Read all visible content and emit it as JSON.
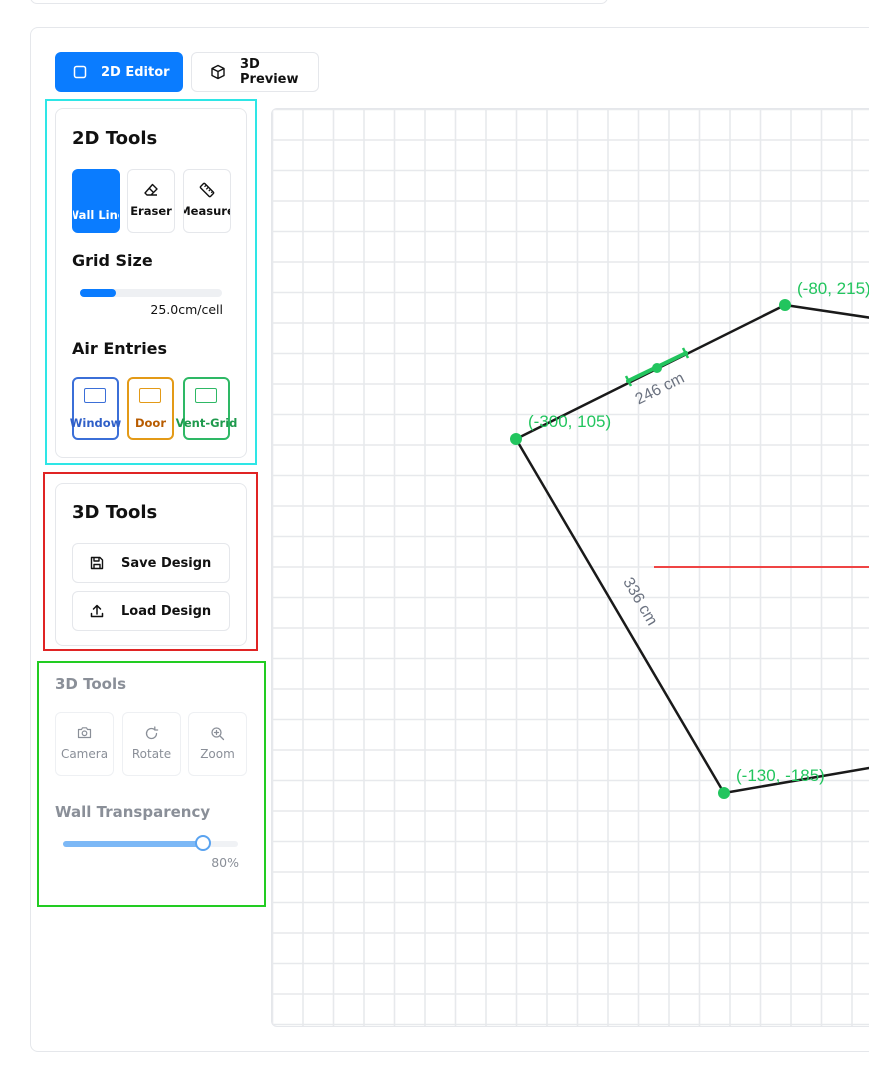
{
  "mode_tabs": {
    "editor_2d": "2D Editor",
    "preview_3d": "3D Preview",
    "active": "2D Editor"
  },
  "tools_2d": {
    "title": "2D Tools",
    "buttons": [
      {
        "label": "Wall Line",
        "icon": "wall-line-icon",
        "active": true
      },
      {
        "label": "Eraser",
        "icon": "eraser-icon",
        "active": false
      },
      {
        "label": "Measure",
        "icon": "ruler-icon",
        "active": false
      }
    ],
    "grid_size": {
      "label": "Grid Size",
      "value_text": "25.0cm/cell",
      "fill_fraction": 0.25
    },
    "air_entries": {
      "title": "Air Entries",
      "items": [
        {
          "label": "Window",
          "color": "#3b6fd8"
        },
        {
          "label": "Door",
          "color": "#e39a17"
        },
        {
          "label": "Vent-Grid",
          "color": "#2eb865"
        }
      ]
    }
  },
  "tools_3d_file": {
    "title": "3D Tools",
    "save_label": "Save Design",
    "load_label": "Load Design"
  },
  "tools_3d_view": {
    "title": "3D Tools",
    "buttons": [
      {
        "label": "Camera",
        "icon": "camera-icon"
      },
      {
        "label": "Rotate",
        "icon": "rotate-icon"
      },
      {
        "label": "Zoom",
        "icon": "zoom-in-icon"
      }
    ],
    "wall_transparency": {
      "label": "Wall Transparency",
      "value_text": "80%",
      "value_fraction": 0.8
    }
  },
  "canvas": {
    "point_labels": [
      "(-80, 215)",
      "(-300, 105)",
      "(-130, -185)"
    ],
    "dimension_labels": [
      "246 cm",
      "336 cm"
    ],
    "colors": {
      "wall": "#1a1a1a",
      "point": "#22c55e",
      "grid": "#e7e9ec",
      "axis": "#ef4444",
      "dimension_text": "#6b7280"
    }
  }
}
